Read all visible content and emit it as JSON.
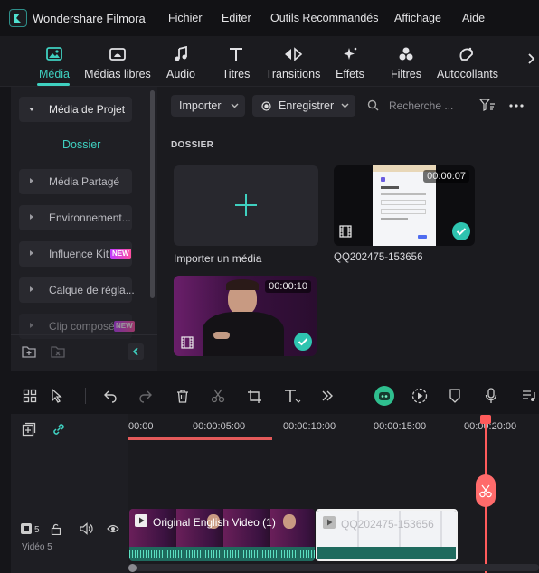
{
  "app": {
    "title": "Wondershare Filmora"
  },
  "menu": [
    "Fichier",
    "Editer",
    "Outils Recommandés",
    "Affichage",
    "Aide"
  ],
  "tool_tabs": [
    {
      "label": "Média",
      "icon": "media-icon",
      "active": true
    },
    {
      "label": "Médias libres",
      "icon": "stock-media-icon"
    },
    {
      "label": "Audio",
      "icon": "music-note-icon"
    },
    {
      "label": "Titres",
      "icon": "text-t-icon"
    },
    {
      "label": "Transitions",
      "icon": "transitions-icon"
    },
    {
      "label": "Effets",
      "icon": "effects-sparkle-icon"
    },
    {
      "label": "Filtres",
      "icon": "filters-circles-icon"
    },
    {
      "label": "Autocollants",
      "icon": "stickers-icon"
    }
  ],
  "sidebar": {
    "project_media": "Média de Projet",
    "folder": "Dossier",
    "items": [
      {
        "label": "Média Partagé"
      },
      {
        "label": "Environnement..."
      },
      {
        "label": "Influence Kit",
        "badge": "NEW"
      },
      {
        "label": "Calque de régla..."
      },
      {
        "label": "Clip composé",
        "badge": "NEW"
      }
    ]
  },
  "media": {
    "import_label": "Importer",
    "record_label": "Enregistrer",
    "search_placeholder": "Recherche ...",
    "section_title": "DOSSIER",
    "import_tile_label": "Importer un média",
    "clips": [
      {
        "name": "QQ202475-153656",
        "duration": "00:00:07"
      },
      {
        "name": "",
        "duration": "00:00:10"
      }
    ]
  },
  "timeline": {
    "ruler": [
      "00:00",
      "00:00:05:00",
      "00:00:10:00",
      "00:00:15:00",
      "00:00:20:00"
    ],
    "track_number": "5",
    "track_name": "Vidéo 5",
    "clips": [
      {
        "label": "Original English Video (1)"
      },
      {
        "label": "QQ202475-153656"
      }
    ]
  },
  "colors": {
    "accent": "#3fd0c0",
    "playhead": "#ff5b5b"
  }
}
